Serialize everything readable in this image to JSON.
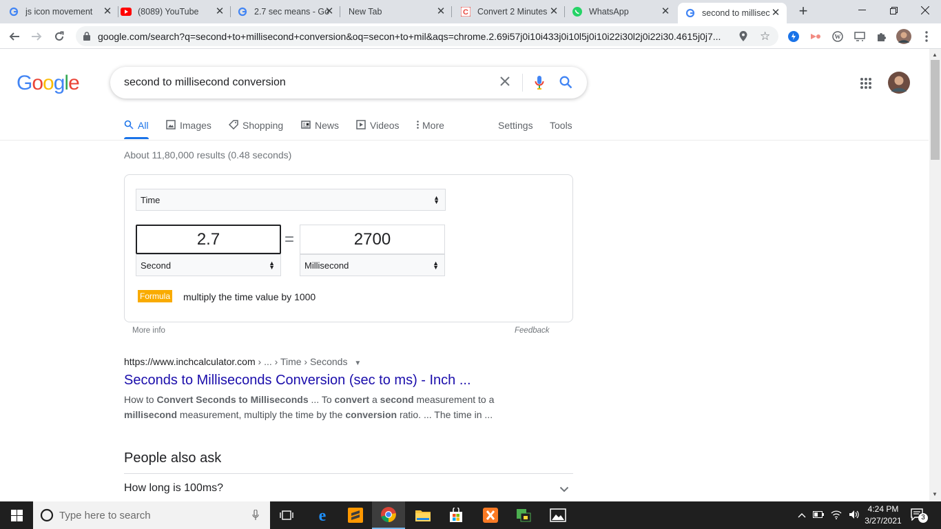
{
  "browser": {
    "tabs": [
      {
        "title": "js icon movement",
        "icon": "google-g"
      },
      {
        "title": "(8089) YouTube",
        "icon": "youtube"
      },
      {
        "title": "2.7 sec means - Go",
        "icon": "google-g"
      },
      {
        "title": "New Tab",
        "icon": "none"
      },
      {
        "title": "Convert 2 Minutes",
        "icon": "convert-c"
      },
      {
        "title": "WhatsApp",
        "icon": "whatsapp"
      },
      {
        "title": "second to millisec",
        "icon": "google-g"
      }
    ],
    "active_tab_index": 6,
    "url": "google.com/search?q=second+to+millisecond+conversion&oq=secon+to+mil&aqs=chrome.2.69i57j0i10i433j0i10l5j0i10i22i30l2j0i22i30.4615j0j7..."
  },
  "google": {
    "logo": [
      "G",
      "o",
      "o",
      "g",
      "l",
      "e"
    ],
    "logo_colors": [
      "#4285f4",
      "#ea4335",
      "#fbbc05",
      "#4285f4",
      "#34a853",
      "#ea4335"
    ],
    "query": "second to millisecond conversion",
    "nav": {
      "all": "All",
      "images": "Images",
      "shopping": "Shopping",
      "news": "News",
      "videos": "Videos",
      "more": "More",
      "settings": "Settings",
      "tools": "Tools"
    },
    "stats": "About 11,80,000 results (0.48 seconds)"
  },
  "converter": {
    "category": "Time",
    "from_value": "2.7",
    "equals": "=",
    "to_value": "2700",
    "from_unit": "Second",
    "to_unit": "Millisecond",
    "formula_badge": "Formula",
    "formula_text": "multiply the time value by 1000",
    "more_info": "More info",
    "feedback": "Feedback"
  },
  "result": {
    "cite_domain": "https://www.inchcalculator.com",
    "cite_path": " › ... › Time › Seconds",
    "title": "Seconds to Milliseconds Conversion (sec to ms) - Inch ...",
    "snippet": [
      {
        "t": "How to ",
        "b": false
      },
      {
        "t": "Convert Seconds to Milliseconds",
        "b": true
      },
      {
        "t": " ... To ",
        "b": false
      },
      {
        "t": "convert",
        "b": true
      },
      {
        "t": " a ",
        "b": false
      },
      {
        "t": "second",
        "b": true
      },
      {
        "t": " measurement to a ",
        "b": false
      },
      {
        "t": "millisecond",
        "b": true
      },
      {
        "t": " measurement, multiply the time by the ",
        "b": false
      },
      {
        "t": "conversion",
        "b": true
      },
      {
        "t": " ratio. ... The time in ...",
        "b": false
      }
    ]
  },
  "people_also_ask": {
    "heading": "People also ask",
    "questions": [
      "How long is 100ms?"
    ]
  },
  "taskbar": {
    "search_placeholder": "Type here to search",
    "time": "4:24 PM",
    "date": "3/27/2021",
    "notification_count": "3"
  }
}
